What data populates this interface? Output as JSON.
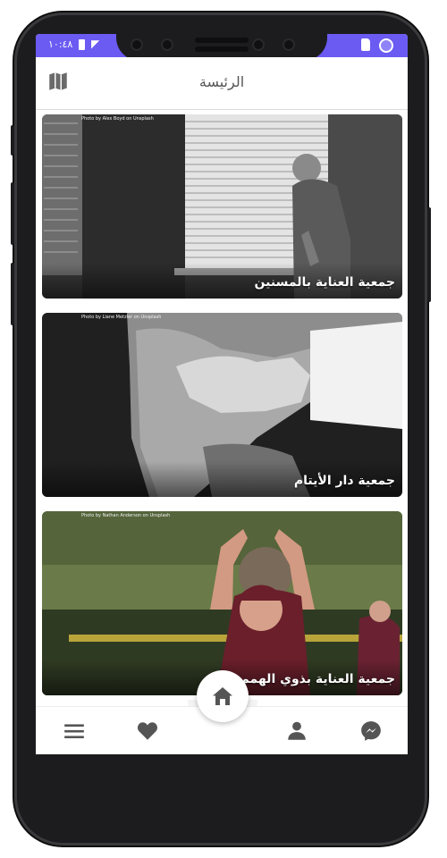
{
  "status_bar": {
    "time": "١٠:٤٨"
  },
  "app_bar": {
    "title": "الرئيسة"
  },
  "cards": [
    {
      "title": "جمعية العناية بالمسنين",
      "credit": "Photo by Alex Boyd on Unsplash"
    },
    {
      "title": "جمعية دار الأيتام",
      "credit": "Photo by Liane Metzler on Unsplash"
    },
    {
      "title": "جمعية العناية بذوي الهمم",
      "credit": "Photo by Nathan Anderson on Unsplash"
    }
  ],
  "icons": {
    "map": "map-icon",
    "home": "home-icon",
    "menu": "hamburger-menu-icon",
    "favorites": "heart-icon",
    "profile": "person-icon",
    "messenger": "messenger-icon"
  },
  "colors": {
    "status_bar": "#6b5bf2",
    "icon": "#555555"
  }
}
